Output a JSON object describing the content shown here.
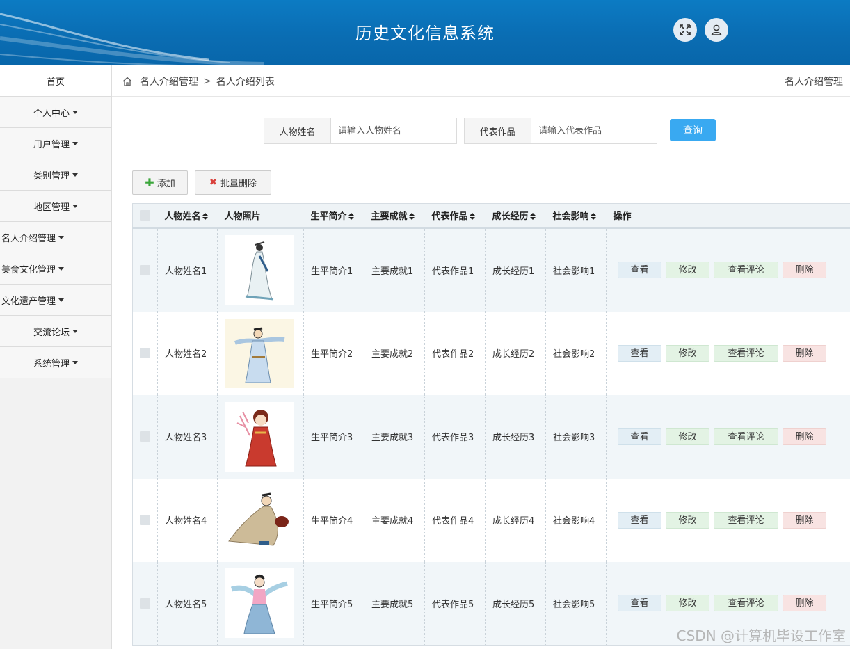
{
  "header": {
    "title": "历史文化信息系统"
  },
  "sidebar": {
    "items": [
      {
        "label": "首页",
        "caret": false
      },
      {
        "label": "个人中心",
        "caret": true
      },
      {
        "label": "用户管理",
        "caret": true
      },
      {
        "label": "类别管理",
        "caret": true
      },
      {
        "label": "地区管理",
        "caret": true
      },
      {
        "label": "名人介绍管理",
        "caret": true
      },
      {
        "label": "美食文化管理",
        "caret": true
      },
      {
        "label": "文化遗产管理",
        "caret": true
      },
      {
        "label": "交流论坛",
        "caret": true
      },
      {
        "label": "系统管理",
        "caret": true
      }
    ]
  },
  "breadcrumb": {
    "level1": "名人介绍管理",
    "separator": ">",
    "level2": "名人介绍列表",
    "right": "名人介绍管理"
  },
  "search": {
    "name_label": "人物姓名",
    "name_placeholder": "请输入人物姓名",
    "work_label": "代表作品",
    "work_placeholder": "请输入代表作品",
    "query_label": "查询"
  },
  "toolbar": {
    "add_label": "添加",
    "batch_delete_label": "批量删除"
  },
  "table": {
    "columns": [
      "人物姓名",
      "人物照片",
      "生平简介",
      "主要成就",
      "代表作品",
      "成长经历",
      "社会影响",
      "操作"
    ],
    "actions": {
      "view": "查看",
      "edit": "修改",
      "comments": "查看评论",
      "delete": "删除"
    },
    "rows": [
      {
        "name": "人物姓名1",
        "bio": "生平简介1",
        "achievement": "主要成就1",
        "work": "代表作品1",
        "growth": "成长经历1",
        "influence": "社会影响1"
      },
      {
        "name": "人物姓名2",
        "bio": "生平简介2",
        "achievement": "主要成就2",
        "work": "代表作品2",
        "growth": "成长经历2",
        "influence": "社会影响2"
      },
      {
        "name": "人物姓名3",
        "bio": "生平简介3",
        "achievement": "主要成就3",
        "work": "代表作品3",
        "growth": "成长经历3",
        "influence": "社会影响3"
      },
      {
        "name": "人物姓名4",
        "bio": "生平简介4",
        "achievement": "主要成就4",
        "work": "代表作品4",
        "growth": "成长经历4",
        "influence": "社会影响4"
      },
      {
        "name": "人物姓名5",
        "bio": "生平简介5",
        "achievement": "主要成就5",
        "work": "代表作品5",
        "growth": "成长经历5",
        "influence": "社会影响5"
      }
    ]
  },
  "watermark": "CSDN @计算机毕设工作室",
  "colors": {
    "header": "#0a6db3",
    "primary_button": "#39a9f1",
    "row_alt": "#f1f6f9"
  }
}
